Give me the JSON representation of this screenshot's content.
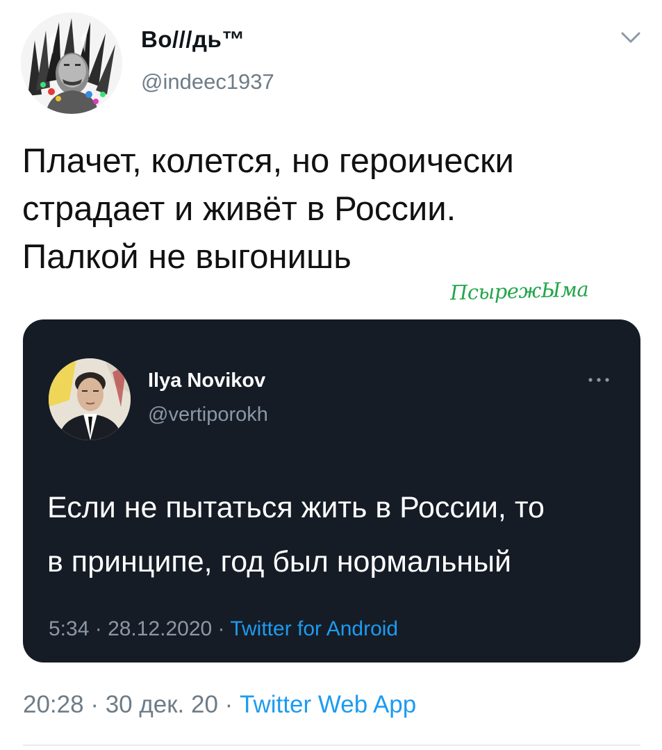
{
  "tweet": {
    "author": {
      "display_name": "Во///дь™",
      "handle": "@indeec1937",
      "avatar": "portrait-headdress-avatar"
    },
    "menu_icon": "chevron-down-icon",
    "text": "Плачет, колется, но героически\nстрадает и живёт в России.\nПалкой не выгонишь",
    "watermark": "ПсырежЫма",
    "quoted": {
      "author": {
        "display_name": "Ilya Novikov",
        "handle": "@vertiporokh",
        "avatar": "man-in-suit-avatar"
      },
      "menu_icon": "more-dots-icon",
      "text": "Если не пытаться жить в России, то\nв принципе, год был нормальный",
      "time": "5:34",
      "date": "28.12.2020",
      "source": "Twitter for Android",
      "separator": " · "
    },
    "time": "20:28",
    "date": "30 дек. 20",
    "source": "Twitter Web App",
    "separator": " · "
  },
  "colors": {
    "text": "#0f1419",
    "secondary": "#6e7c87",
    "link": "#1d9bf0",
    "card_bg": "#161c26",
    "watermark": "#22a64a"
  }
}
